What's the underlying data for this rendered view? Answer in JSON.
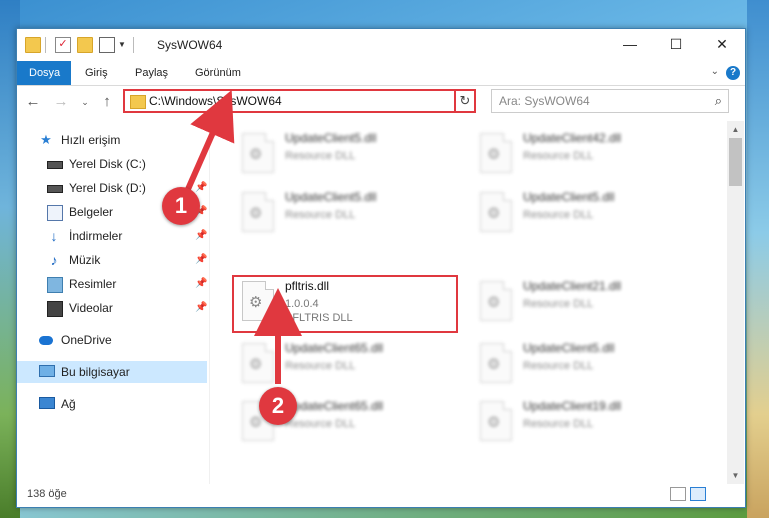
{
  "window": {
    "title": "SysWOW64",
    "controls": {
      "minimize": "—",
      "maximize": "☐",
      "close": "✕"
    }
  },
  "ribbon": {
    "tabs": [
      "Dosya",
      "Giriş",
      "Paylaş",
      "Görünüm"
    ]
  },
  "navigation": {
    "address": "C:\\Windows\\SysWOW64",
    "search_placeholder": "Ara: SysWOW64"
  },
  "sidebar": {
    "items": [
      {
        "label": "Hızlı erişim",
        "icon": "star-icon",
        "pinned": false
      },
      {
        "label": "Yerel Disk (C:)",
        "icon": "disk-icon",
        "pinned": false
      },
      {
        "label": "Yerel Disk (D:)",
        "icon": "disk-icon",
        "pinned": true
      },
      {
        "label": "Belgeler",
        "icon": "documents-icon",
        "pinned": true
      },
      {
        "label": "İndirmeler",
        "icon": "download-icon",
        "pinned": true
      },
      {
        "label": "Müzik",
        "icon": "music-icon",
        "pinned": true
      },
      {
        "label": "Resimler",
        "icon": "pictures-icon",
        "pinned": true
      },
      {
        "label": "Videolar",
        "icon": "videos-icon",
        "pinned": true
      },
      {
        "label": "OneDrive",
        "icon": "cloud-icon",
        "pinned": false
      },
      {
        "label": "Bu bilgisayar",
        "icon": "computer-icon",
        "pinned": false,
        "selected": true
      },
      {
        "label": "Ağ",
        "icon": "network-icon",
        "pinned": false
      }
    ]
  },
  "files": [
    {
      "name": "UpdateClient5.dll",
      "type": "Resource DLL",
      "blurred": true
    },
    {
      "name": "UpdateClient42.dll",
      "type": "Resource DLL",
      "blurred": true
    },
    {
      "name": "UpdateClient5.dll",
      "type": "Resource DLL",
      "blurred": true
    },
    {
      "name": "UpdateClient5.dll",
      "type": "Resource DLL",
      "blurred": true
    },
    {
      "name": "pfltris.dll",
      "version": "1.0.0.4",
      "type": "PFLTRIS DLL",
      "blurred": false,
      "highlighted": true
    },
    {
      "name": "UpdateClient21.dll",
      "type": "Resource DLL",
      "blurred": true
    },
    {
      "name": "UpdateClient65.dll",
      "type": "Resource DLL",
      "blurred": true
    },
    {
      "name": "UpdateClient5.dll",
      "type": "Resource DLL",
      "blurred": true
    },
    {
      "name": "UpdateClient65.dll",
      "type": "Resource DLL",
      "blurred": true
    },
    {
      "name": "UpdateClient19.dll",
      "type": "Resource DLL",
      "blurred": true
    }
  ],
  "status": {
    "item_count": "138 öğe"
  },
  "annotations": {
    "callout_1": "1",
    "callout_2": "2",
    "color": "#e0383f"
  }
}
